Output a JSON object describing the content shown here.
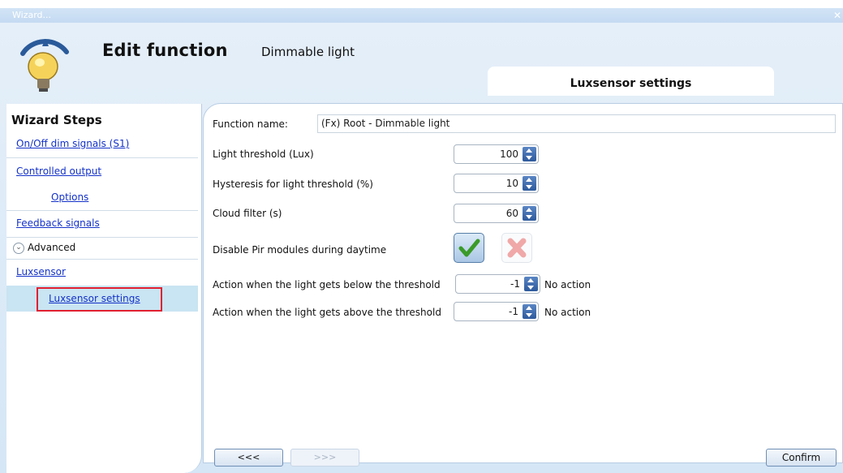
{
  "window": {
    "title": "Wizard..."
  },
  "header": {
    "title": "Edit function",
    "subtitle": "Dimmable light",
    "tab_label": "Luxsensor settings"
  },
  "wizard": {
    "title": "Wizard Steps",
    "steps": [
      {
        "label": "On/Off dim signals (S1)"
      },
      {
        "label": "Controlled output"
      },
      {
        "label": "Options"
      },
      {
        "label": "Feedback signals"
      },
      {
        "label": "Advanced"
      },
      {
        "label": "Luxsensor"
      },
      {
        "label": "Luxsensor settings"
      }
    ]
  },
  "form": {
    "function_name_label": "Function name:",
    "function_name_value": "(Fx) Root - Dimmable light",
    "light_threshold_label": "Light threshold (Lux)",
    "light_threshold_value": "100",
    "hysteresis_label": "Hysteresis for light threshold (%)",
    "hysteresis_value": "10",
    "cloud_filter_label": "Cloud filter (s)",
    "cloud_filter_value": "60",
    "disable_pir_label": "Disable Pir modules during daytime",
    "below_label": "Action when the light gets below the threshold",
    "below_value": "-1",
    "below_action": "No action",
    "above_label": "Action when the light gets above the threshold",
    "above_value": "-1",
    "above_action": "No action"
  },
  "footer": {
    "prev_label": "<<<",
    "next_label": ">>>",
    "confirm_label": "Confirm"
  },
  "colors": {
    "accent": "#2e5a9c",
    "link": "#1432c8",
    "highlight_border": "#e02030",
    "selected_bg": "#c9e4f2"
  }
}
